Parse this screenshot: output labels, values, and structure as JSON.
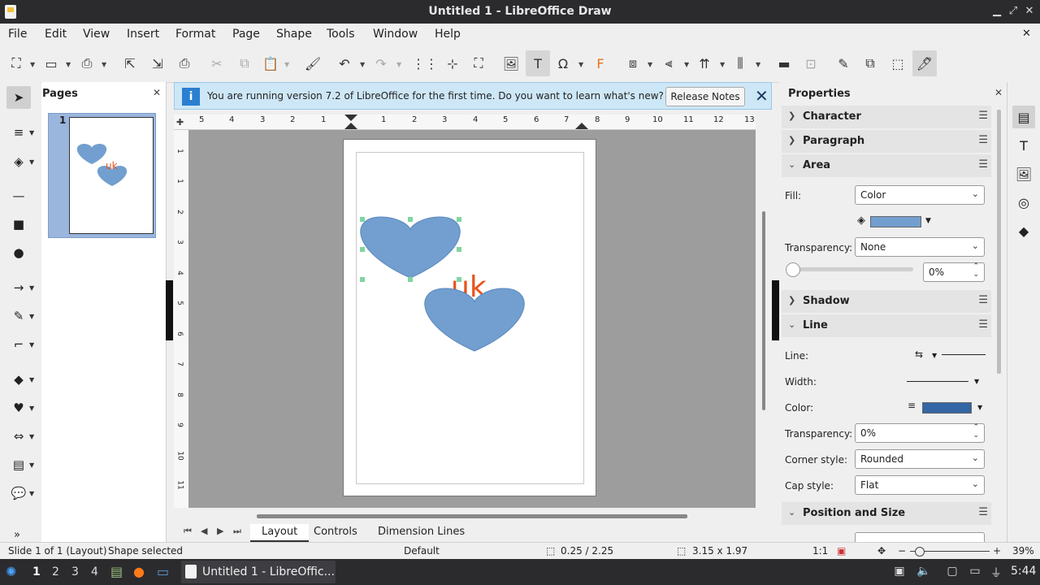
{
  "window": {
    "title": "Untitled 1 - LibreOffice Draw"
  },
  "menubar": [
    "File",
    "Edit",
    "View",
    "Insert",
    "Format",
    "Page",
    "Shape",
    "Tools",
    "Window",
    "Help"
  ],
  "infobar": {
    "text": "You are running version 7.2 of LibreOffice for the first time. Do you want to learn what's new?",
    "button": "Release Notes",
    "icon": "i"
  },
  "pages_panel": {
    "title": "Pages",
    "page_number": "1"
  },
  "rulers": {
    "horizontal": [
      "5",
      "4",
      "3",
      "2",
      "1",
      "1",
      "2",
      "3",
      "4",
      "5",
      "6",
      "7",
      "8",
      "9",
      "10",
      "11",
      "12",
      "13"
    ],
    "vertical": [
      "1",
      "1",
      "2",
      "3",
      "4",
      "5",
      "6",
      "7",
      "8",
      "9",
      "10",
      "11"
    ]
  },
  "canvas": {
    "text_shape": "uk",
    "shape_color": "#729fcf",
    "text_color": "#e8541e",
    "handle_color": "#7fd6a0"
  },
  "tabs": [
    "Layout",
    "Controls",
    "Dimension Lines"
  ],
  "properties": {
    "title": "Properties",
    "sections": {
      "character": "Character",
      "paragraph": "Paragraph",
      "area": "Area",
      "shadow": "Shadow",
      "line": "Line",
      "position": "Position and Size"
    },
    "area": {
      "fill_label": "Fill:",
      "fill_value": "Color",
      "fill_color": "#729fcf",
      "transparency_label": "Transparency:",
      "transparency_value": "None",
      "slider_value": "0%",
      "slider_percent": 0
    },
    "line": {
      "line_label": "Line:",
      "width_label": "Width:",
      "color_label": "Color:",
      "color": "#3465a4",
      "transparency_label": "Transparency:",
      "transparency_value": "0%",
      "corner_label": "Corner style:",
      "corner_value": "Rounded",
      "cap_label": "Cap style:",
      "cap_value": "Flat"
    }
  },
  "status": {
    "slide": "Slide 1 of 1 (Layout)",
    "selection": "Shape selected",
    "master": "Default",
    "position": "0.25 / 2.25",
    "size": "3.15 x 1.97",
    "scale": "1:1",
    "zoom": "39%"
  },
  "taskbar": {
    "workspaces": [
      "1",
      "2",
      "3",
      "4"
    ],
    "task": "Untitled 1 - LibreOffic...",
    "clock": "5:44"
  }
}
